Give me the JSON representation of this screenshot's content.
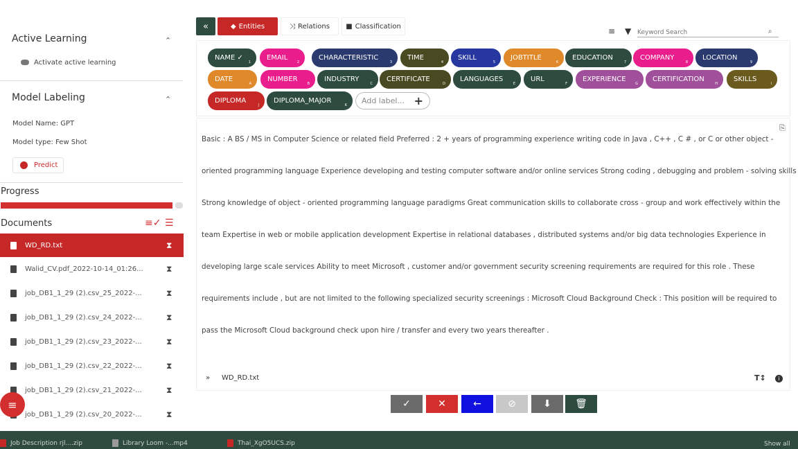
{
  "sidebar": {
    "active_learning": {
      "title": "Active Learning",
      "toggle_label": "Activate active learning"
    },
    "model_labeling": {
      "title": "Model Labeling",
      "model_name": "Model Name: GPT",
      "model_type": "Model type: Few Shot",
      "predict_label": "Predict"
    },
    "progress": {
      "label": "Progress",
      "value": 0.95
    },
    "documents": {
      "label": "Documents",
      "items": [
        {
          "name": "WD_RD.txt",
          "active": true
        },
        {
          "name": "Walid_CV.pdf_2022-10-14_01:26...",
          "active": false
        },
        {
          "name": "job_DB1_1_29 (2).csv_25_2022-...",
          "active": false
        },
        {
          "name": "job_DB1_1_29 (2).csv_24_2022-...",
          "active": false
        },
        {
          "name": "job_DB1_1_29 (2).csv_23_2022-...",
          "active": false
        },
        {
          "name": "job_DB1_1_29 (2).csv_22_2022-...",
          "active": false
        },
        {
          "name": "job_DB1_1_29 (2).csv_21_2022-...",
          "active": false
        },
        {
          "name": "job_DB1_1_29 (2).csv_20_2022-...",
          "active": false
        }
      ]
    }
  },
  "tabs": {
    "back": "«",
    "entities": "Entities",
    "relations": "Relations",
    "classification": "Classification"
  },
  "search": {
    "placeholder": "Keyword Search"
  },
  "labels": [
    {
      "text": "NAME ✓",
      "key": "1",
      "color": "#2e4b3f"
    },
    {
      "text": "EMAIL",
      "key": "2",
      "color": "#e91e8c"
    },
    {
      "text": "CHARACTERISTIC",
      "key": "3",
      "color": "#2b3a6e"
    },
    {
      "text": "TIME",
      "key": "4",
      "color": "#4a4a22"
    },
    {
      "text": "SKILL",
      "key": "5",
      "color": "#2638a0"
    },
    {
      "text": "JOBTITLE",
      "key": "6",
      "color": "#e0892a"
    },
    {
      "text": "EDUCATION",
      "key": "7",
      "color": "#2e4b3f"
    },
    {
      "text": "COMPANY",
      "key": "8",
      "color": "#e91e8c"
    },
    {
      "text": "LOCATION",
      "key": "9",
      "color": "#2b3a6e"
    },
    {
      "text": "DATE",
      "key": "A",
      "color": "#e0892a"
    },
    {
      "text": "NUMBER",
      "key": "B",
      "color": "#e91e8c"
    },
    {
      "text": "INDUSTRY",
      "key": "C",
      "color": "#2e4b3f"
    },
    {
      "text": "CERTIFICATE",
      "key": "D",
      "color": "#4a4a22"
    },
    {
      "text": "LANGUAGES",
      "key": "E",
      "color": "#2e4b3f"
    },
    {
      "text": "URL",
      "key": "F",
      "color": "#2e4b3f"
    },
    {
      "text": "EXPERIENCE",
      "key": "G",
      "color": "#a0509a"
    },
    {
      "text": "CERTIFICATION",
      "key": "H",
      "color": "#a0509a"
    },
    {
      "text": "SKILLS",
      "key": "I",
      "color": "#6b5a1e"
    },
    {
      "text": "DIPLOMA",
      "key": "J",
      "color": "#c62828"
    },
    {
      "text": "DIPLOMA_MAJOR",
      "key": "K",
      "color": "#2e4b3f"
    }
  ],
  "add_label": {
    "placeholder": "Add label..."
  },
  "document_text": [
    "Basic : A BS / MS in Computer Science or related field Preferred : 2 + years of programming experience writing code in Java , C++ , C # , or C or other object -",
    "oriented programming language Experience developing and testing computer software and/or online services Strong coding , debugging and problem - solving skills",
    "Strong knowledge of object - oriented programming language paradigms Great communication skills to collaborate cross - group and work effectively within the",
    "team Expertise in web or mobile application development Expertise in relational databases , distributed systems and/or big data technologies Experience in",
    "developing large scale services Ability to meet Microsoft , customer and/or government security screening requirements are required for this role . These",
    "requirements include , but are not limited to the following specialized security screenings : Microsoft Cloud Background Check : This position will be required to",
    "pass the Microsoft Cloud background check upon hire / transfer and every two years thereafter ."
  ],
  "footer": {
    "filename": "WD_RD.txt"
  },
  "actions": [
    {
      "name": "accept",
      "glyph": "✓",
      "color": "#6b6b6b"
    },
    {
      "name": "reject",
      "glyph": "✕",
      "color": "#d32f2f"
    },
    {
      "name": "back",
      "glyph": "←",
      "color": "#1010e0"
    },
    {
      "name": "ignore",
      "glyph": "⊘",
      "color": "#c8c8c8"
    },
    {
      "name": "save",
      "glyph": "⬇",
      "color": "#6b6b6b"
    },
    {
      "name": "delete",
      "glyph": "🗑",
      "color": "#2e4b3f"
    }
  ],
  "taskbar": {
    "items": [
      "Job Description rjl....zip",
      "Library   Loom -...mp4",
      "Thai_XgO5UCS.zip"
    ],
    "show_all": "Show all"
  }
}
